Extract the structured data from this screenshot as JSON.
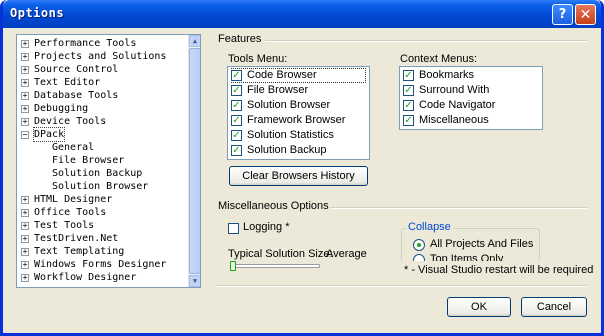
{
  "window": {
    "title": "Options"
  },
  "title_buttons": {
    "help": "?",
    "close": "✕"
  },
  "tree": {
    "items": [
      {
        "label": "Performance Tools",
        "expander": "+"
      },
      {
        "label": "Projects and Solutions",
        "expander": "+"
      },
      {
        "label": "Source Control",
        "expander": "+"
      },
      {
        "label": "Text Editor",
        "expander": "+"
      },
      {
        "label": "Database Tools",
        "expander": "+"
      },
      {
        "label": "Debugging",
        "expander": "+"
      },
      {
        "label": "Device Tools",
        "expander": "+"
      },
      {
        "label": "DPack",
        "expander": "−"
      },
      {
        "label": "General",
        "expander": ""
      },
      {
        "label": "File Browser",
        "expander": ""
      },
      {
        "label": "Solution Backup",
        "expander": ""
      },
      {
        "label": "Solution Browser",
        "expander": ""
      },
      {
        "label": "HTML Designer",
        "expander": "+"
      },
      {
        "label": "Office Tools",
        "expander": "+"
      },
      {
        "label": "Test Tools",
        "expander": "+"
      },
      {
        "label": "TestDriven.Net",
        "expander": "+"
      },
      {
        "label": "Text Templating",
        "expander": "+"
      },
      {
        "label": "Windows Forms Designer",
        "expander": "+"
      },
      {
        "label": "Workflow Designer",
        "expander": "+"
      }
    ],
    "scroll_up": "▲",
    "scroll_down": "▼"
  },
  "features": {
    "heading": "Features",
    "tools_menu": {
      "label": "Tools Menu:",
      "items": [
        {
          "label": "Code Browser",
          "check": "✓"
        },
        {
          "label": "File Browser",
          "check": "✓"
        },
        {
          "label": "Solution Browser",
          "check": "✓"
        },
        {
          "label": "Framework Browser",
          "check": "✓"
        },
        {
          "label": "Solution Statistics",
          "check": "✓"
        },
        {
          "label": "Solution Backup",
          "check": "✓"
        }
      ]
    },
    "context_menus": {
      "label": "Context Menus:",
      "items": [
        {
          "label": "Bookmarks",
          "check": "✓"
        },
        {
          "label": "Surround With",
          "check": "✓"
        },
        {
          "label": "Code Navigator",
          "check": "✓"
        },
        {
          "label": "Miscellaneous",
          "check": "✓"
        }
      ]
    },
    "clear_history_button": "Clear Browsers History"
  },
  "misc": {
    "heading": "Miscellaneous Options",
    "logging_label": "Logging *",
    "logging_checked": false,
    "solution_size_label": "Typical Solution Size:",
    "solution_size_value": "Average",
    "collapse": {
      "title": "Collapse",
      "options": [
        "All Projects And Files",
        "Top Items Only"
      ],
      "selected": "All Projects And Files"
    },
    "restart_note": "* - Visual Studio restart will be required"
  },
  "buttons": {
    "ok": "OK",
    "cancel": "Cancel"
  },
  "colors": {
    "title_blue": "#0047D0",
    "check_green": "#21A121",
    "group_title": "#0046D5"
  }
}
